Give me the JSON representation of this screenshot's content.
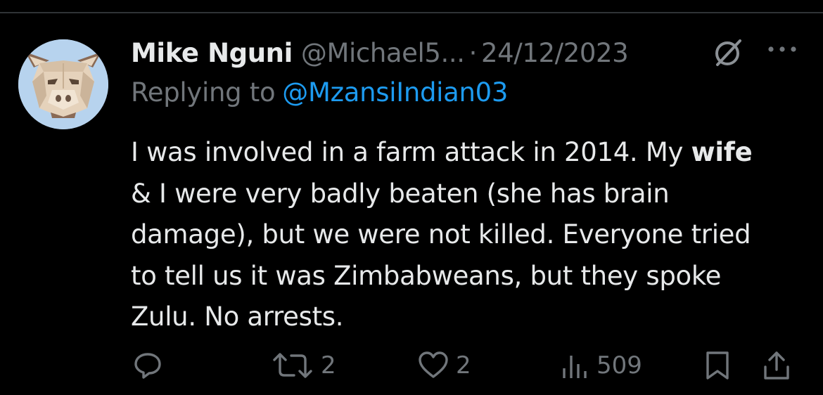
{
  "tweet": {
    "author_name": "Mike Nguni",
    "author_handle": "@Michael5...",
    "separator": "·",
    "date": "24/12/2023",
    "replying_prefix": "Replying to",
    "replying_handle": "@MzansiIndian03",
    "body_lines": [
      [
        "I was involved in a farm attack in 2014. My ",
        "wife"
      ],
      [
        "& I were very badly beaten (she has brain"
      ],
      [
        "damage), but we were not killed. Everyone tried"
      ],
      [
        "to tell us it was Zimbabweans, but they spoke"
      ],
      [
        "Zulu. No arrests."
      ]
    ]
  },
  "actions": {
    "reply_count": "",
    "retweet_count": "2",
    "like_count": "2",
    "views_count": "509"
  },
  "icons": {
    "avatar": "pig-face-avatar",
    "grok": "grok-icon",
    "more": "more-icon",
    "reply": "reply-icon",
    "retweet": "retweet-icon",
    "like": "heart-icon",
    "views": "views-icon",
    "bookmark": "bookmark-icon",
    "share": "share-icon"
  },
  "colors": {
    "background": "#000000",
    "text_primary": "#e7e9ea",
    "text_secondary": "#71767b",
    "link": "#1d9bf0"
  }
}
